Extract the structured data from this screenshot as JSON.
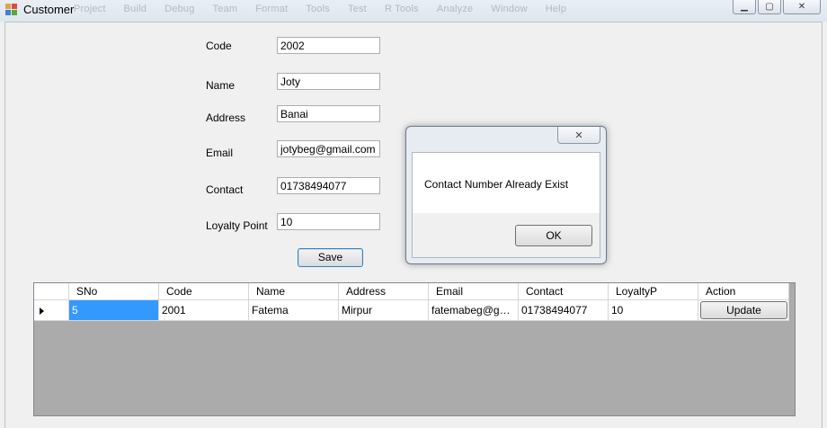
{
  "window": {
    "title": "Customer",
    "ghost_menu": [
      "Project",
      "Build",
      "Debug",
      "Team",
      "Format",
      "Tools",
      "Test",
      "R Tools",
      "Analyze",
      "Window",
      "Help"
    ],
    "controls": {
      "minimize": "▁",
      "maximize": "▢",
      "close": "✕"
    }
  },
  "form": {
    "code_label": "Code",
    "code_value": "2002",
    "name_label": "Name",
    "name_value": "Joty",
    "address_label": "Address",
    "address_value": "Banai",
    "email_label": "Email",
    "email_value": "jotybeg@gmail.com",
    "contact_label": "Contact",
    "contact_value": "01738494077",
    "loyalty_label": "Loyalty Point",
    "loyalty_value": "10",
    "save_label": "Save"
  },
  "grid": {
    "columns": [
      "SNo",
      "Code",
      "Name",
      "Address",
      "Email",
      "Contact",
      "LoyaltyP",
      "Action"
    ],
    "rows": [
      {
        "sno": "5",
        "code": "2001",
        "name": "Fatema",
        "address": "Mirpur",
        "email": "fatemabeg@gmai...",
        "contact": "01738494077",
        "loyalty": "10",
        "action": "Update"
      }
    ]
  },
  "dialog": {
    "message": "Contact Number Already Exist",
    "ok_label": "OK",
    "close_glyph": "✕"
  }
}
